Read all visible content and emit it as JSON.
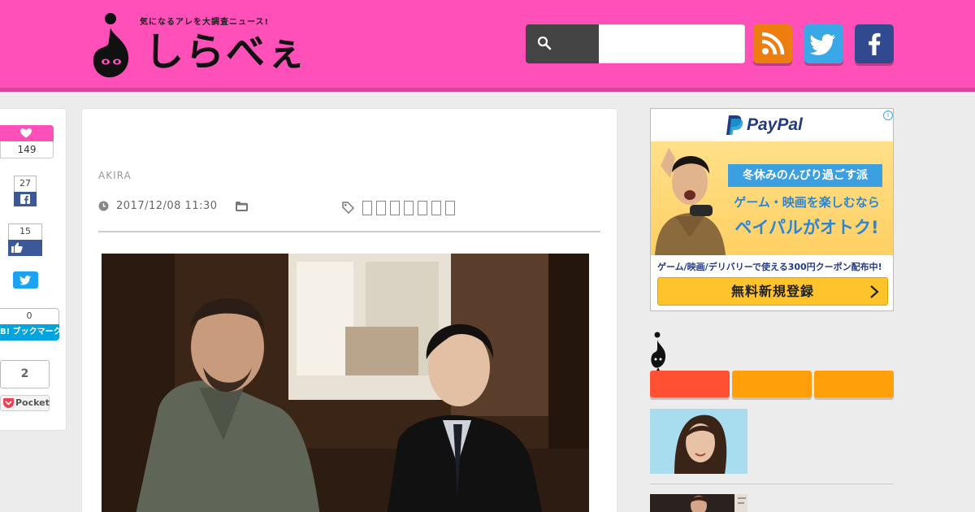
{
  "header": {
    "tagline": "気になるアレを大調査ニュース!",
    "brand": "しらべぇ",
    "search_value": "",
    "search_icon": "search-icon"
  },
  "social": [
    {
      "name": "rss-icon",
      "color": "#ec7d0f"
    },
    {
      "name": "twitter-icon",
      "color": "#3aa8e6"
    },
    {
      "name": "facebook-icon",
      "color": "#314a8f"
    }
  ],
  "share": {
    "likes": "149",
    "facebook_share": "27",
    "facebook_like": "15",
    "hatena_count": "0",
    "hatena_label": "B! ブックマーク",
    "pocket_count": "2",
    "pocket_label": "Pocket"
  },
  "article": {
    "author": "AKIRA",
    "date": "2017/12/08 11:30",
    "tag_placeholder_count": 7
  },
  "ad": {
    "brand": "PayPal",
    "chip": "冬休みのんびり過ごす派",
    "line2": "ゲーム・映画を楽しむなら",
    "line3": "ペイパルがオトク!",
    "coupon": "ゲーム/映画/デリバリーで使える300円クーポン配布中!",
    "cta": "無料新規登録",
    "info": "i"
  },
  "colors": {
    "brand_pink": "#ff4fb8",
    "tab_red": "#ff5034",
    "tab_orange": "#ff9f0a"
  }
}
